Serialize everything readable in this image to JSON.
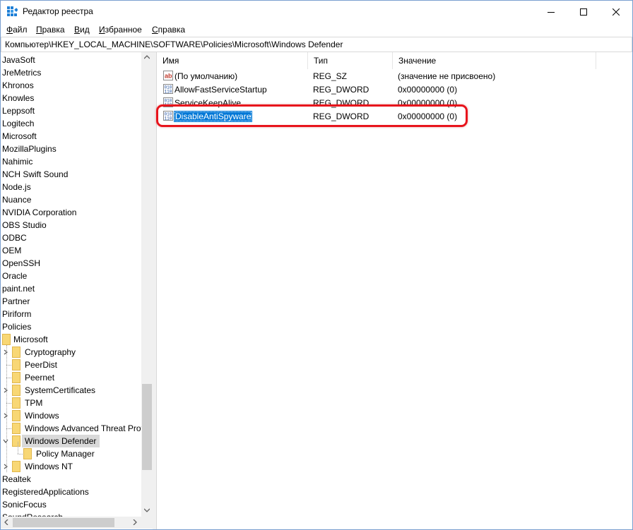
{
  "window": {
    "title": "Редактор реестра",
    "controls": {
      "minimize": "minimize",
      "maximize": "maximize",
      "close": "close"
    }
  },
  "menu": [
    {
      "label": "Файл"
    },
    {
      "label": "Правка"
    },
    {
      "label": "Вид"
    },
    {
      "label": "Избранное"
    },
    {
      "label": "Справка"
    }
  ],
  "address": {
    "path": "Компьютер\\HKEY_LOCAL_MACHINE\\SOFTWARE\\Policies\\Microsoft\\Windows Defender"
  },
  "tree": {
    "top_items": [
      "JavaSoft",
      "JreMetrics",
      "Khronos",
      "Knowles",
      "Leppsoft",
      "Logitech",
      "Microsoft",
      "MozillaPlugins",
      "Nahimic",
      "NCH Swift Sound",
      "Node.js",
      "Nuance",
      "NVIDIA Corporation",
      "OBS Studio",
      "ODBC",
      "OEM",
      "OpenSSH",
      "Oracle",
      "paint.net",
      "Partner",
      "Piriform",
      "Policies"
    ],
    "policies_microsoft": "Microsoft",
    "microsoft_children": [
      {
        "label": "Cryptography",
        "expandable": true
      },
      {
        "label": "PeerDist",
        "expandable": false
      },
      {
        "label": "Peernet",
        "expandable": false
      },
      {
        "label": "SystemCertificates",
        "expandable": true
      },
      {
        "label": "TPM",
        "expandable": false
      },
      {
        "label": "Windows",
        "expandable": true
      },
      {
        "label": "Windows Advanced Threat Prot",
        "expandable": false
      },
      {
        "label": "Windows Defender",
        "expandable": true,
        "selected": true
      },
      {
        "label": "Policy Manager",
        "child": true
      },
      {
        "label": "Windows NT",
        "expandable": true
      }
    ],
    "bottom_items": [
      "Realtek",
      "RegisteredApplications",
      "SonicFocus",
      "SoundResearch"
    ]
  },
  "list": {
    "columns": {
      "name": "Имя",
      "type": "Тип",
      "value": "Значение"
    },
    "rows": [
      {
        "name": "(По умолчанию)",
        "type": "REG_SZ",
        "value": "(значение не присвоено)",
        "icon": "string-value-icon"
      },
      {
        "name": "AllowFastServiceStartup",
        "type": "REG_DWORD",
        "value": "0x00000000 (0)",
        "icon": "dword-value-icon"
      },
      {
        "name": "ServiceKeepAlive",
        "type": "REG_DWORD",
        "value": "0x00000000 (0)",
        "icon": "dword-value-icon"
      },
      {
        "name": "DisableAntiSpyware",
        "type": "REG_DWORD",
        "value": "0x00000000 (0)",
        "icon": "dword-value-icon",
        "selected": true
      }
    ]
  },
  "colors": {
    "selection": "#0078d7",
    "highlight_ring": "#e8141c",
    "folder": "#f8d775"
  }
}
